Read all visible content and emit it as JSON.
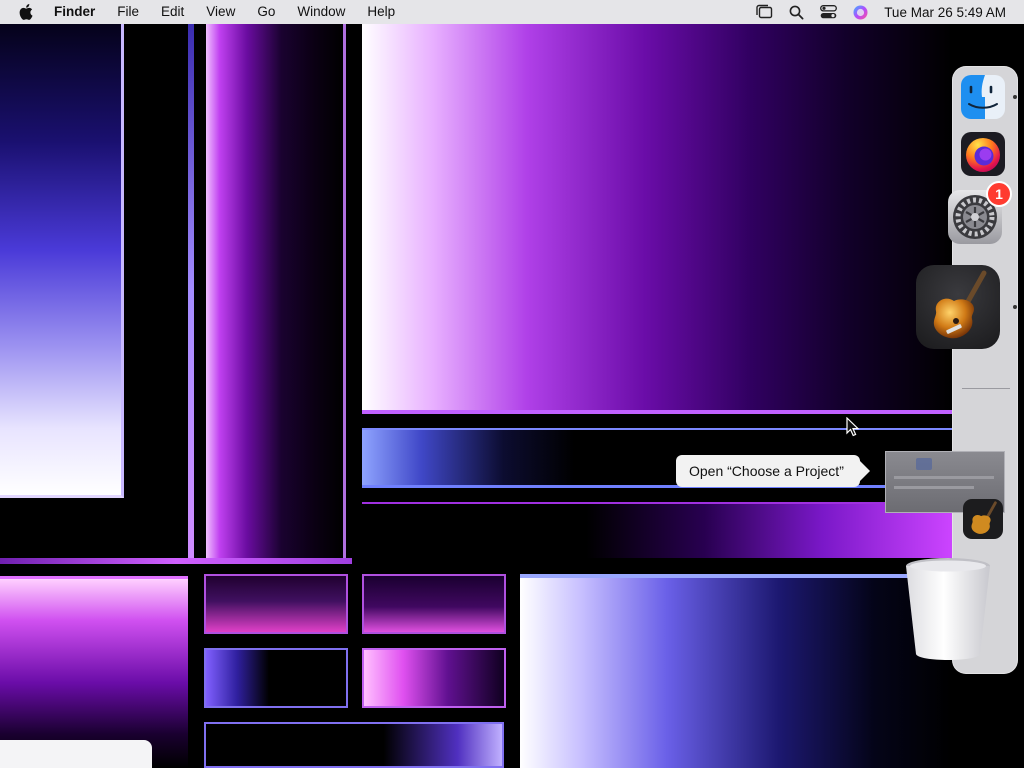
{
  "menubar": {
    "app_name": "Finder",
    "menus": [
      "File",
      "Edit",
      "View",
      "Go",
      "Window",
      "Help"
    ],
    "status_icons": [
      "stage-manager-icon",
      "spotlight-search-icon",
      "control-center-icon",
      "siri-icon"
    ],
    "clock": "Tue Mar 26  5:49 AM"
  },
  "dock": {
    "apps": [
      {
        "name": "Finder",
        "icon": "finder-icon",
        "running": true
      },
      {
        "name": "Firefox",
        "icon": "firefox-icon",
        "running": false
      },
      {
        "name": "System Settings",
        "icon": "system-settings-icon",
        "running": false,
        "badge": "1"
      },
      {
        "name": "GarageBand",
        "icon": "garageband-icon",
        "running": true
      }
    ],
    "tooltip": "Open “Choose a Project”",
    "minimized_window": "garageband-window-thumbnail",
    "trash_icon": "trash-icon"
  },
  "colors": {
    "menubar_bg": "#e5e5e8",
    "dock_bg": "#ececf0",
    "badge": "#ff3b30"
  }
}
